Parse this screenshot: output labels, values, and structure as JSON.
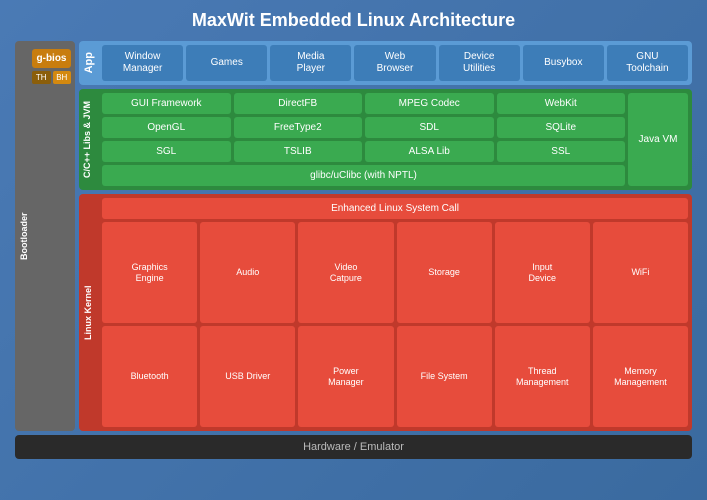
{
  "title": "MaxWit Embedded Linux Architecture",
  "layers": {
    "app": {
      "label": "App",
      "items": [
        {
          "label": "Window\nManager"
        },
        {
          "label": "Games"
        },
        {
          "label": "Media\nPlayer"
        },
        {
          "label": "Web\nBrowser"
        },
        {
          "label": "Device\nUtilities"
        },
        {
          "label": "Busybox"
        },
        {
          "label": "GNU\nToolchain"
        }
      ]
    },
    "libs": {
      "label": "C/C++ Libs & JVM",
      "rows": [
        [
          "GUI Framework",
          "DirectFB",
          "MPEG Codec",
          "WebKit"
        ],
        [
          "OpenGL",
          "FreeType2",
          "SDL",
          "SQLite"
        ],
        [
          "SGL",
          "TSLIB",
          "ALSA Lib",
          "SSL"
        ]
      ],
      "javavm": "Java VM",
      "glibc": "glibc/uClibc (with NPTL)"
    },
    "kernel": {
      "label": "Linux Kernel",
      "syscall": "Enhanced Linux System Call",
      "rows": [
        [
          "Graphics\nEngine",
          "Audio",
          "Video\nCatpure",
          "Storage",
          "Input\nDevice",
          "WiFi"
        ],
        [
          "Bluetooth",
          "USB Driver",
          "Power\nManager",
          "File System",
          "Thread\nManagement",
          "Memory\nManagement"
        ]
      ]
    },
    "hardware": "Hardware / Emulator",
    "bootloader": {
      "label": "Bootloader",
      "gbios": "g-bios",
      "th": "TH",
      "bh": "BH"
    }
  }
}
